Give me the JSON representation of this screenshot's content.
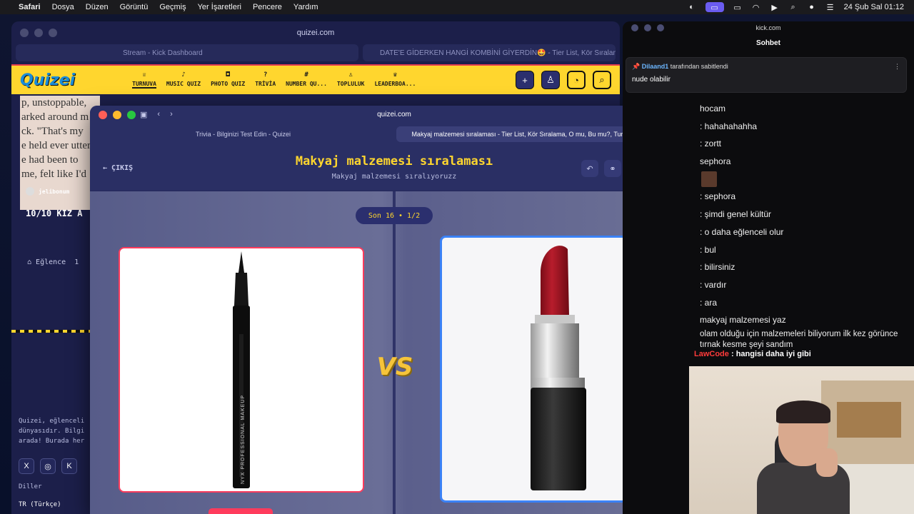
{
  "menubar": {
    "app": "Safari",
    "items": [
      "Dosya",
      "Düzen",
      "Görüntü",
      "Geçmiş",
      "Yer İşaretleri",
      "Pencere",
      "Yardım"
    ],
    "clock": "24 Şub Sal  01:12"
  },
  "back_window": {
    "url": "quizei.com",
    "tabs": [
      "Stream - Kick Dashboard",
      "DATE'E GİDERKEN HANGİ KOMBİNİ GİYERDİN🤩 - Tier List, Kör Sıralama, O mu, Bu mu?, Tur..."
    ],
    "logo": "Quizei",
    "nav": [
      {
        "icon": "♕",
        "label": "TURNUVA"
      },
      {
        "icon": "♪",
        "label": "MUSIC QUIZ"
      },
      {
        "icon": "◘",
        "label": "PHOTO QUIZ"
      },
      {
        "icon": "?",
        "label": "TRİVİA"
      },
      {
        "icon": "#",
        "label": "NUMBER QU..."
      },
      {
        "icon": "♙",
        "label": "TOPLULUK"
      },
      {
        "icon": "♛",
        "label": "LEADERBOA..."
      }
    ],
    "book_lines": [
      "p, unstoppable,",
      "arked around m",
      "ck. \"That's my",
      "e held ever utter",
      "e had been to",
      "me, felt like I'd"
    ],
    "card_user": "jelibonum",
    "card_title": "10/10 KIZ A",
    "card_category": "Eğlence",
    "card_extra": "1",
    "footer_text": [
      "Quizei, eğlenceli",
      "dünyasıdır. Bilgi",
      "arada! Burada her"
    ],
    "diller": "Diller",
    "language": "TR (Türkçe)"
  },
  "front_window": {
    "url": "quizei.com",
    "tabs": [
      "Trivia - Bilginizi Test Edin - Quizei",
      "Makyaj malzemesi sıralaması - Tier List, Kör Sıralama, O mu, Bu mu?, Turnuva Ağacı - Quizei"
    ],
    "exit_label": "ÇIKIŞ",
    "title": "Makyaj malzemesi sıralaması",
    "subtitle": "Makyaj malzemesi sıralıyoruzz",
    "round": "Son 16 • 1/2",
    "vs": "VS",
    "left_item": "NYX Professional Makeup eyeliner",
    "right_item": "red lipstick",
    "pen_text": "NYX PROFESSIONAL MAKEUP"
  },
  "chat": {
    "url": "kick.com",
    "header": "Sohbet",
    "pinned_by_user": "Dilaand1",
    "pinned_by_suffix": "tarafından sabitlendi",
    "pinned_message": "nude olabilir",
    "messages": [
      "hocam",
      ": hahahahahha",
      ": zortt",
      "sephora",
      "",
      ": sephora",
      ": şimdi genel kültür",
      ": o daha eğlenceli olur",
      ": bul",
      ": bilirsiniz",
      ": vardır",
      ": ara",
      "makyaj malzemesi yaz"
    ],
    "multi_message": "olam olduğu için malzemeleri biliyorum ilk kez görünce tırnak kesme şeyi sandım",
    "last_user": "LawCode",
    "last_message": ": hangisi daha iyi gibi"
  }
}
